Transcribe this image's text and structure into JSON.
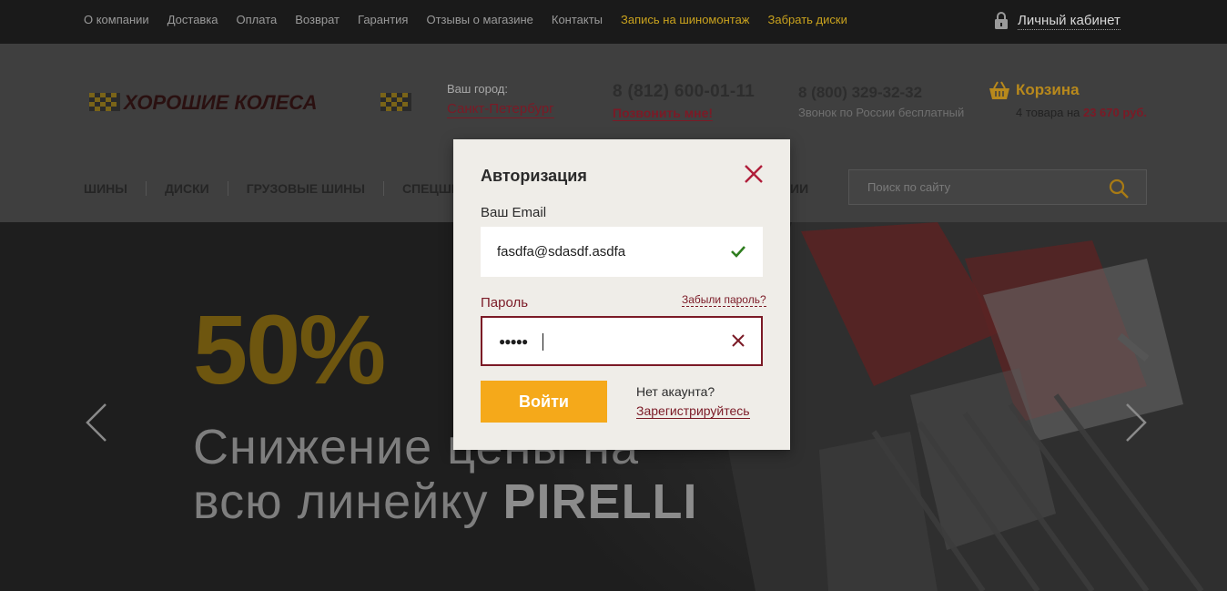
{
  "topbar": {
    "links": [
      "О компании",
      "Доставка",
      "Оплата",
      "Возврат",
      "Гарантия",
      "Отзывы о магазине",
      "Контакты"
    ],
    "highlight_links": [
      "Запись на шиномонтаж",
      "Забрать диски"
    ],
    "cabinet_label": "Личный кабинет"
  },
  "header": {
    "logo_text": "ХОРОШИЕ КОЛЕСА",
    "city_caption": "Ваш город:",
    "city_value": "Санкт-Петербург",
    "phone1": "8 (812) 600-01-11",
    "call_me": "Позвонить мне!",
    "phone2": "8 (800) 329-32-32",
    "phone2_note": "Звонок по России бесплатный",
    "cart_label": "Корзина",
    "cart_summary": "4 товара на",
    "cart_total": "23 670 руб."
  },
  "mainnav": {
    "items": [
      "ШИНЫ",
      "ДИСКИ",
      "ГРУЗОВЫЕ ШИНЫ",
      "СПЕЦШИ"
    ],
    "tail": "ИИ",
    "search_placeholder": "Поиск по сайту"
  },
  "hero": {
    "percent": "50%",
    "line1": "Снижение цены на",
    "line2_prefix": "всю линейку",
    "line2_brand": "PIRELLI"
  },
  "modal": {
    "title": "Авторизация",
    "email_label": "Ваш Email",
    "email_value": "fasdfa@sdasdf.asdfa",
    "password_label": "Пароль",
    "forgot_label": "Забыли пароль?",
    "password_value": "●●●●●",
    "login_button": "Войти",
    "no_account": "Нет акаунта?",
    "register_link": "Зарегистрируйтесь"
  },
  "colors": {
    "accent_yellow": "#f5a91a",
    "error_red": "#7b1a26",
    "ok_green": "#2e7d1e"
  }
}
